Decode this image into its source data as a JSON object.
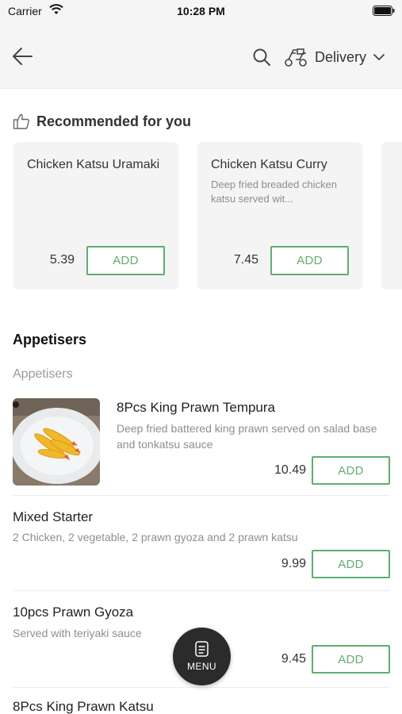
{
  "status_bar": {
    "carrier": "Carrier",
    "time": "10:28 PM"
  },
  "nav": {
    "delivery_label": "Delivery"
  },
  "recommended": {
    "title": "Recommended for you",
    "cards": [
      {
        "name": "Chicken Katsu Uramaki",
        "description": "",
        "price": "5.39",
        "add_label": "ADD"
      },
      {
        "name": "Chicken Katsu Curry",
        "description": "Deep fried breaded chicken katsu served wit...",
        "price": "7.45",
        "add_label": "ADD"
      }
    ]
  },
  "menu_section": {
    "title": "Appetisers",
    "subtitle": "Appetisers",
    "items": [
      {
        "name": "8Pcs King Prawn Tempura",
        "description": "Deep fried battered king prawn served on salad base and tonkatsu sauce",
        "price": "10.49",
        "add_label": "ADD"
      },
      {
        "name": "Mixed Starter",
        "description": "2 Chicken, 2 vegetable, 2 prawn gyoza and 2 prawn katsu",
        "price": "9.99",
        "add_label": "ADD"
      },
      {
        "name": "10pcs Prawn Gyoza",
        "description": "Served with teriyaki sauce",
        "price": "9.45",
        "add_label": "ADD"
      },
      {
        "name": "8Pcs King Prawn Katsu"
      }
    ]
  },
  "fab": {
    "label": "MENU"
  },
  "colors": {
    "accent": "#5fae6e",
    "card_bg": "#f4f4f4",
    "header_bg": "#f5f5f5"
  },
  "icons": [
    "wifi-icon",
    "battery-icon",
    "back-arrow-icon",
    "search-icon",
    "scooter-icon",
    "chevron-down-icon",
    "thumbs-up-icon",
    "menu-icon"
  ]
}
